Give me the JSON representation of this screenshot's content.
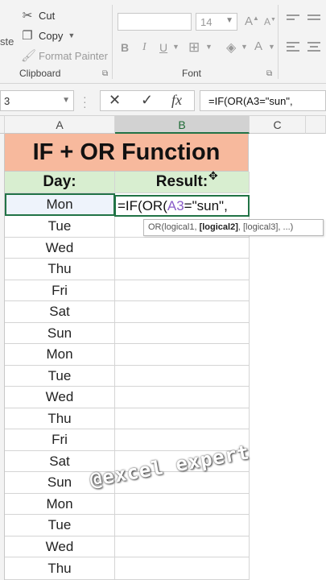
{
  "ribbon": {
    "paste_label": "ste",
    "cut_label": "Cut",
    "copy_label": "Copy",
    "format_painter_label": "Format Painter",
    "clipboard_group": "Clipboard",
    "font_group": "Font",
    "font_size": "14",
    "bold": "B",
    "italic": "I",
    "underline": "U"
  },
  "formula_bar": {
    "name_box": "3",
    "fx": "fx",
    "formula": "=IF(OR(A3=\"sun\","
  },
  "columns": [
    "A",
    "B",
    "C"
  ],
  "sheet": {
    "title": "IF + OR Function",
    "day_header": "Day:",
    "result_header": "Result:",
    "days": [
      "Mon",
      "Tue",
      "Wed",
      "Thu",
      "Fri",
      "Sat",
      "Sun",
      "Mon",
      "Tue",
      "Wed",
      "Thu",
      "Fri",
      "Sat",
      "Sun",
      "Mon",
      "Tue",
      "Wed",
      "Thu"
    ]
  },
  "editing": {
    "prefix": "=IF(OR(",
    "ref": "A3",
    "suffix": "=\"sun\","
  },
  "tooltip": {
    "func": "OR(logical1, ",
    "current_arg": "[logical2]",
    "rest": ", [logical3], ...)"
  },
  "watermark": "@excel expert",
  "colors": {
    "accent": "#217346",
    "title_fill": "#f7b99d",
    "header_fill": "#d8eed0",
    "ref_color": "#8a5cc8"
  }
}
